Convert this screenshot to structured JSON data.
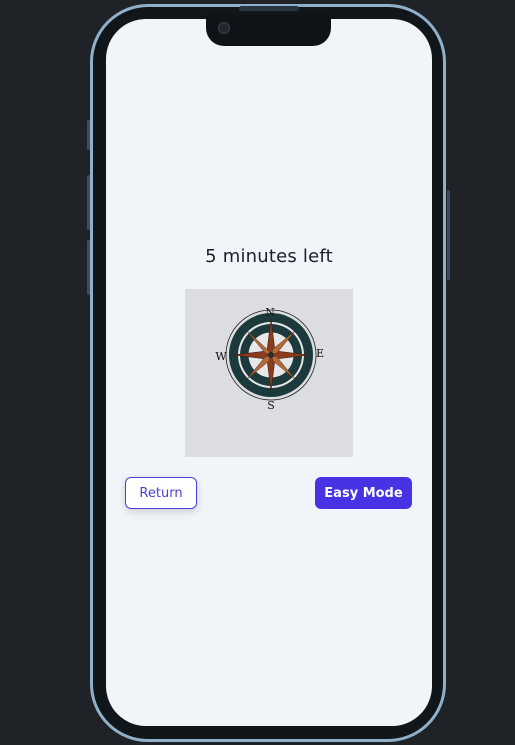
{
  "game": {
    "timer_text": "5 minutes left",
    "image": {
      "icon": "compass-rose-icon",
      "directions": {
        "north": "N",
        "south": "S",
        "east": "E",
        "west": "W"
      }
    }
  },
  "buttons": {
    "return_label": "Return",
    "easy_mode_label": "Easy Mode"
  },
  "colors": {
    "accent": "#4733e3",
    "screen_background": "#f1f5f9"
  }
}
